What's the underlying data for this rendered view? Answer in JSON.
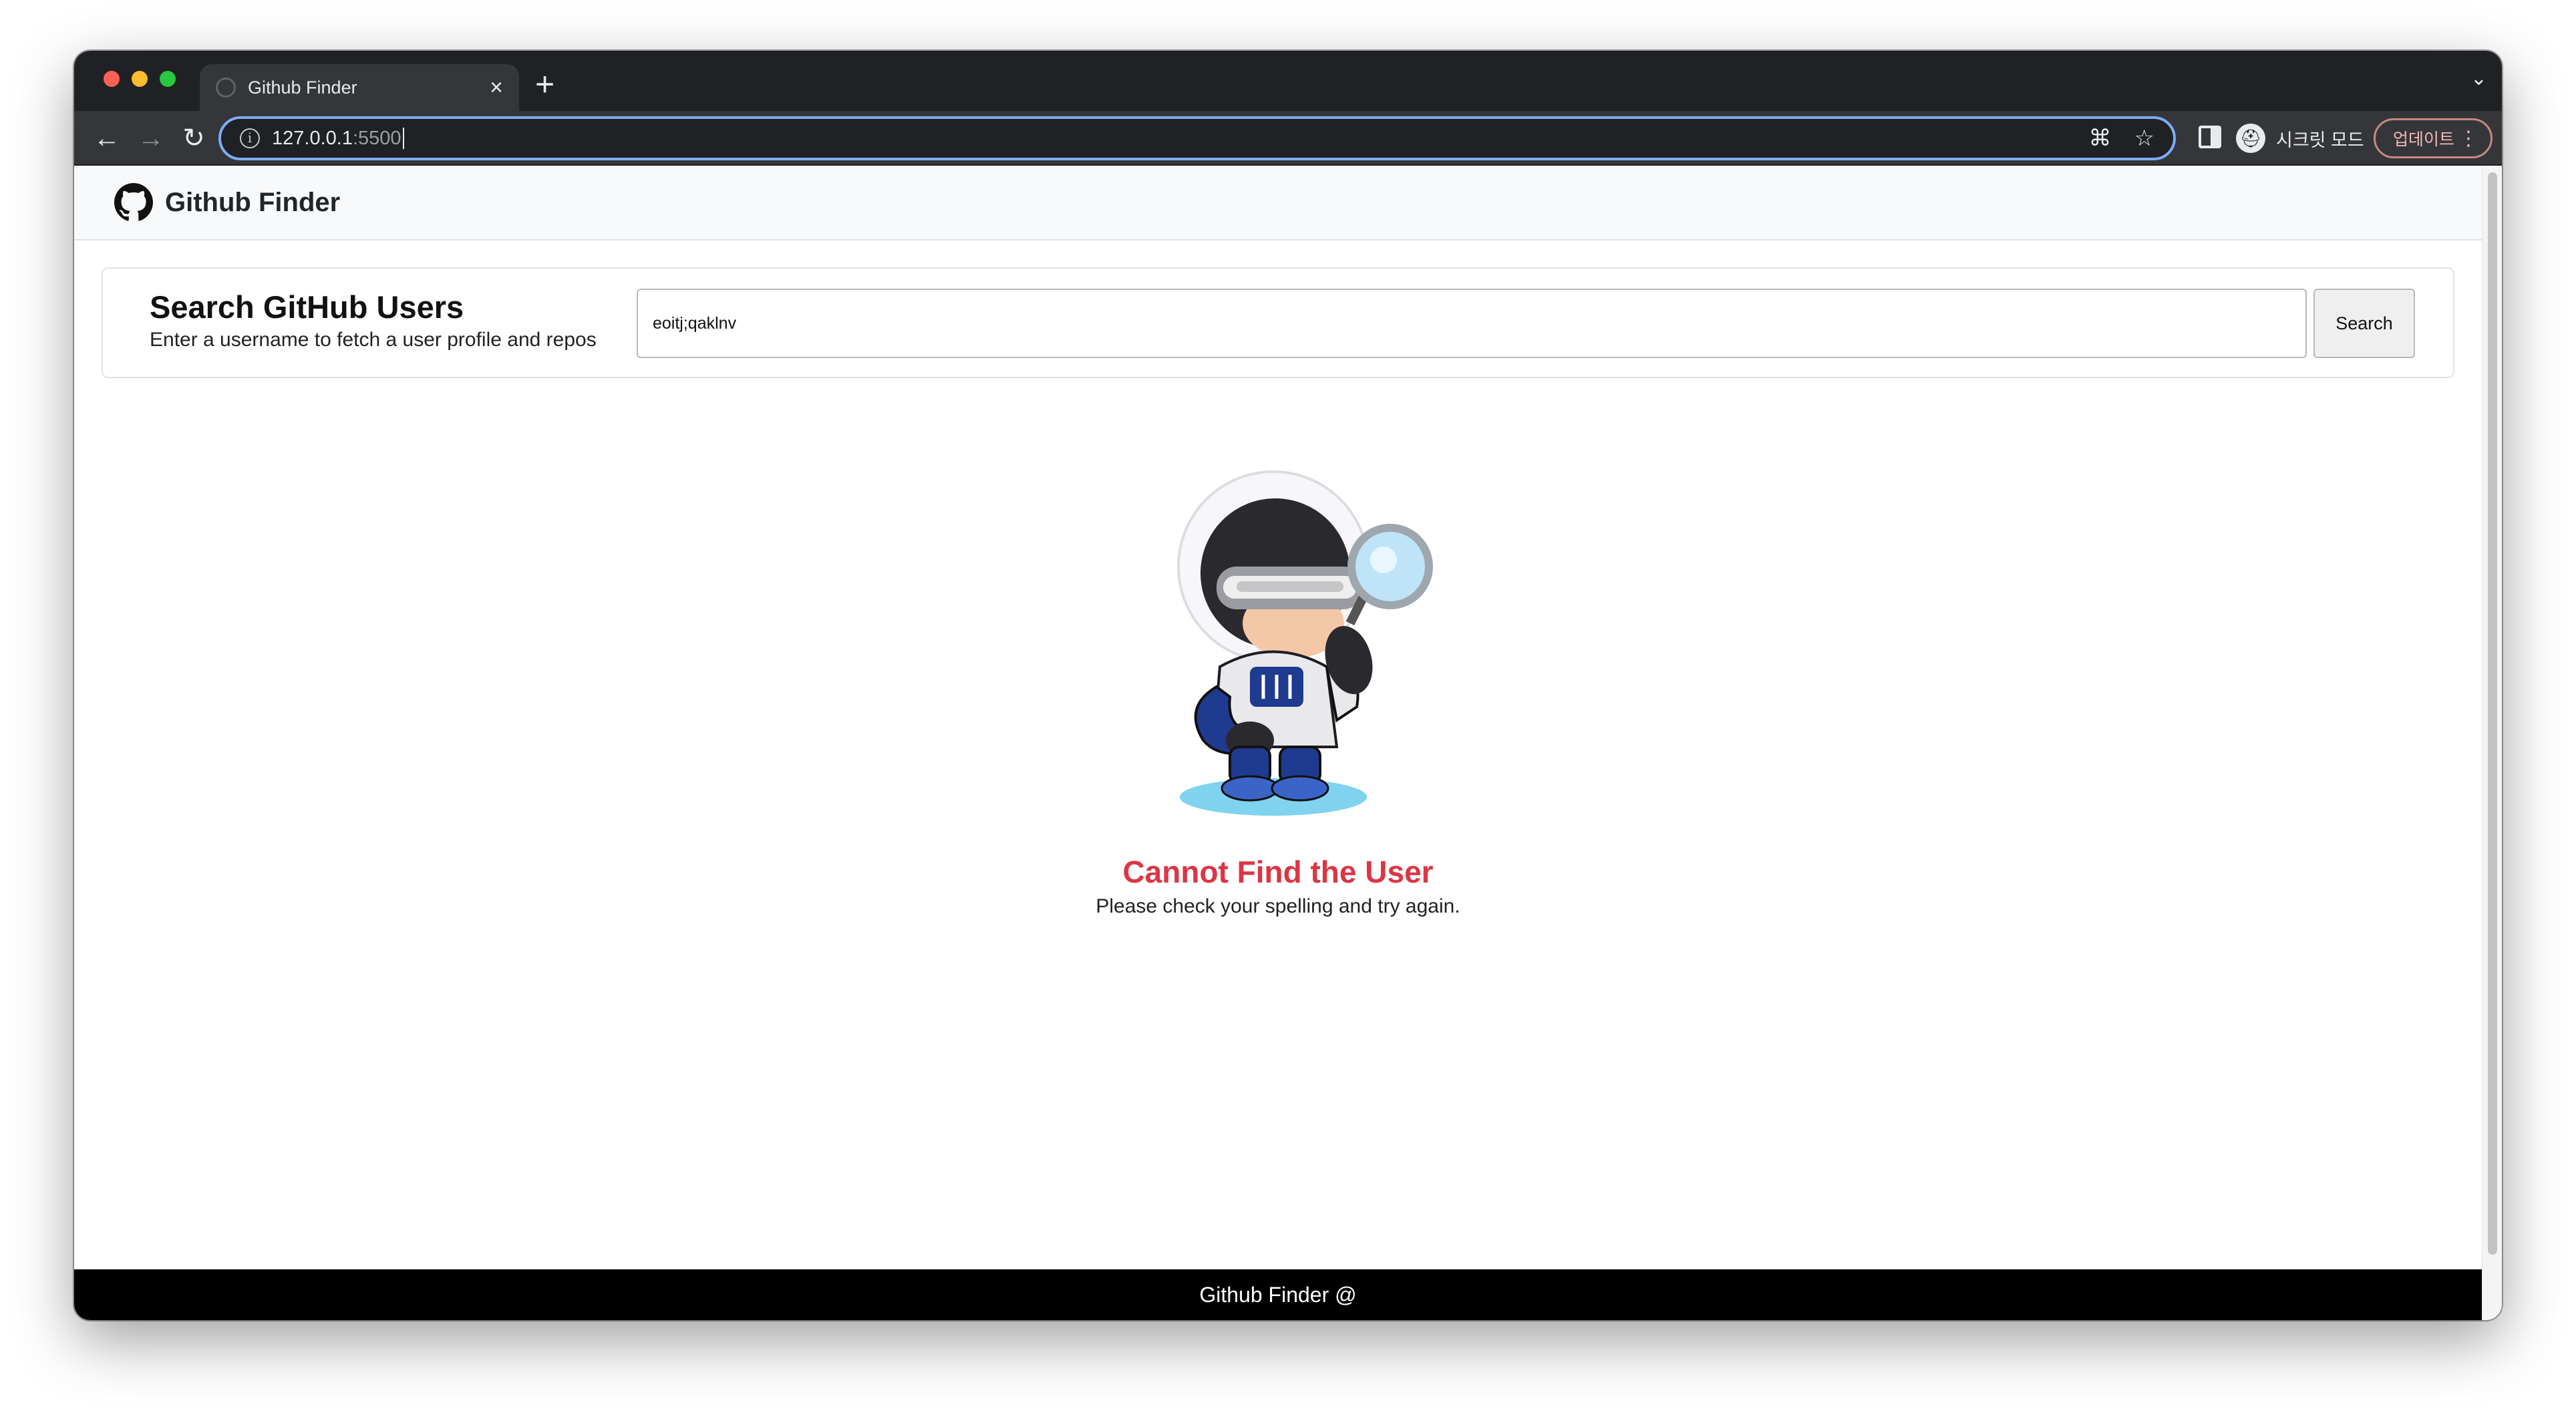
{
  "browser": {
    "tab_title": "Github Finder",
    "tab_close": "×",
    "new_tab": "+",
    "tab_search": "⌄",
    "url_host": "127.0.0.1",
    "url_port": ":5500",
    "incognito_label": "시크릿 모드",
    "update_label": "업데이트",
    "back_icon": "←",
    "forward_icon": "→",
    "reload_icon": "↻"
  },
  "app": {
    "brand": "Github Finder"
  },
  "search": {
    "heading": "Search GitHub Users",
    "subheading": "Enter a username to fetch a user profile and repos",
    "input_value": "eoitj;qaklnv",
    "button_label": "Search"
  },
  "error": {
    "title": "Cannot Find the User",
    "message": "Please check your spelling and try again."
  },
  "footer": {
    "text": "Github Finder @"
  },
  "icons": {
    "brand": "github-octocat-icon",
    "illustration": "detective-octocat-illustration"
  },
  "colors": {
    "error": "#dc3545",
    "footer_bg": "#000000",
    "nav_bg": "#f8f9fa",
    "browser_accent": "#7cacf8"
  }
}
